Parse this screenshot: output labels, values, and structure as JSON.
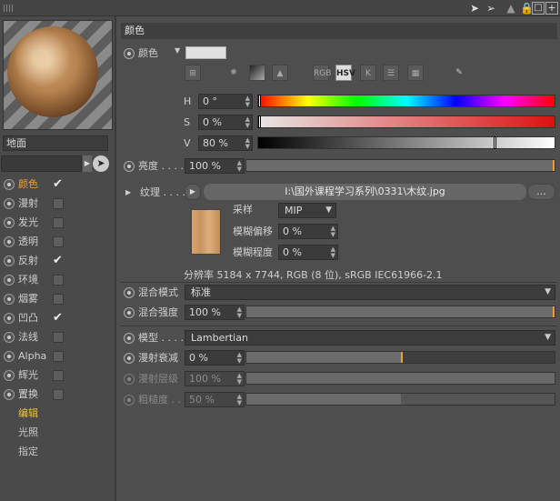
{
  "left_panel": {
    "material_name": "地面",
    "channels": [
      {
        "label": "颜色",
        "checked": true,
        "active": true
      },
      {
        "label": "漫射",
        "checked": false
      },
      {
        "label": "发光",
        "checked": false
      },
      {
        "label": "透明",
        "checked": false
      },
      {
        "label": "反射",
        "checked": true
      },
      {
        "label": "环境",
        "checked": false
      },
      {
        "label": "烟雾",
        "checked": false
      },
      {
        "label": "凹凸",
        "checked": true
      },
      {
        "label": "法线",
        "checked": false
      },
      {
        "label": "Alpha",
        "checked": false
      },
      {
        "label": "辉光",
        "checked": false
      },
      {
        "label": "置换",
        "checked": false
      }
    ],
    "sub_items": [
      {
        "label": "编辑",
        "active": true
      },
      {
        "label": "光照"
      },
      {
        "label": "指定"
      }
    ]
  },
  "section_title": "颜色",
  "color": {
    "label": "颜色",
    "modes": [
      "RGB",
      "HSV",
      "K"
    ],
    "active_mode": "HSV",
    "h_label": "H",
    "h_value": "0 °",
    "h_fraction": 0.0,
    "s_label": "S",
    "s_value": "0 %",
    "s_fraction": 0.0,
    "v_label": "V",
    "v_value": "80 %",
    "v_fraction": 0.8
  },
  "brightness": {
    "label": "亮度 . . . .",
    "value": "100 %",
    "fraction": 1.0
  },
  "texture": {
    "label": "纹理 . . . .",
    "path": "I:\\国外课程学习系列\\0331\\木纹.jpg",
    "more_button": "...",
    "sampling_label": "采样",
    "sampling_value": "MIP",
    "blur_offset_label": "模糊偏移",
    "blur_offset_value": "0 %",
    "blur_level_label": "模糊程度",
    "blur_level_value": "0 %",
    "resolution_info": "分辨率 5184 x 7744, RGB (8 位), sRGB IEC61966-2.1"
  },
  "mix_mode": {
    "label": "混合模式",
    "value": "标准"
  },
  "mix_strength": {
    "label": "混合强度",
    "value": "100 %",
    "fraction": 1.0
  },
  "model": {
    "label": "模型 . . . .",
    "value": "Lambertian"
  },
  "diffuse_falloff": {
    "label": "漫射衰减",
    "value": "0 %",
    "fraction": 0.0
  },
  "diffuse_level": {
    "label": "漫射层级",
    "value": "100 %",
    "fraction": 1.0
  },
  "roughness": {
    "label": "粗糙度 . .",
    "value": "50 %",
    "fraction": 0.5
  }
}
